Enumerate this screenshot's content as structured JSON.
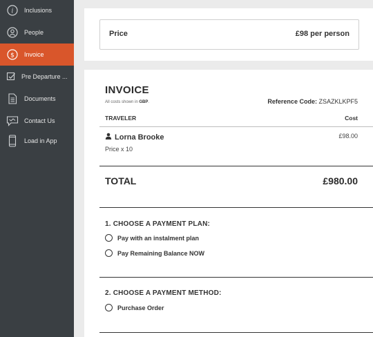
{
  "sidebar": {
    "items": [
      {
        "label": "Inclusions",
        "icon": "info-icon"
      },
      {
        "label": "People",
        "icon": "people-icon"
      },
      {
        "label": "Invoice",
        "icon": "dollar-icon",
        "active": true
      },
      {
        "label": "Pre Departure ...",
        "icon": "checklist-icon"
      },
      {
        "label": "Documents",
        "icon": "document-icon"
      },
      {
        "label": "Contact Us",
        "icon": "chat-icon"
      },
      {
        "label": "Load in App",
        "icon": "phone-icon"
      }
    ]
  },
  "price": {
    "label": "Price",
    "value": "£98 per person"
  },
  "invoice": {
    "title": "INVOICE",
    "currency_prefix": "All costs shown in",
    "currency": "GBP",
    "currency_suffix": ".",
    "reference_label": "Reference Code:",
    "reference_code": "ZSAZKLKPF5",
    "col_traveler": "TRAVELER",
    "col_cost": "Cost",
    "traveler": {
      "name": "Lorna Brooke",
      "cost": "£98.00",
      "desc": "Price x 10"
    },
    "total_label": "TOTAL",
    "total_value": "£980.00"
  },
  "payment_plan": {
    "title": "1. CHOOSE A PAYMENT PLAN:",
    "options": [
      "Pay with an instalment plan",
      "Pay Remaining Balance NOW"
    ]
  },
  "payment_method": {
    "title": "2. CHOOSE A PAYMENT METHOD:",
    "options": [
      "Purchase Order"
    ]
  },
  "colors": {
    "sidebar": "#3a3f43",
    "accent": "#d9562b",
    "background": "#ebebeb"
  }
}
